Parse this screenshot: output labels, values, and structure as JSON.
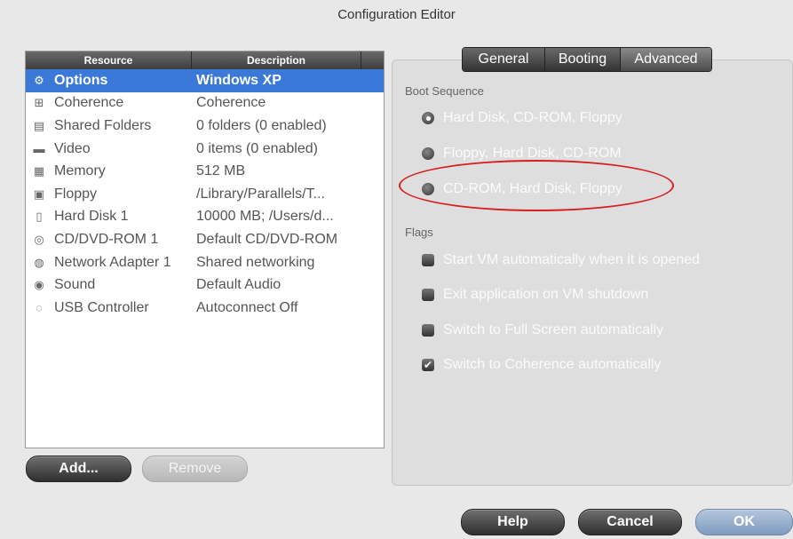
{
  "window": {
    "title": "Configuration Editor"
  },
  "list": {
    "headers": {
      "resource": "Resource",
      "description": "Description"
    },
    "rows": [
      {
        "icon": "gear-icon",
        "glyph": "⚙",
        "resource": "Options",
        "description": "Windows XP",
        "selected": true
      },
      {
        "icon": "coherence-icon",
        "glyph": "⊞",
        "resource": "Coherence",
        "description": "Coherence"
      },
      {
        "icon": "shared-folder-icon",
        "glyph": "▤",
        "resource": "Shared Folders",
        "description": "0 folders (0 enabled)"
      },
      {
        "icon": "monitor-icon",
        "glyph": "▬",
        "resource": "Video",
        "description": "0 items (0 enabled)"
      },
      {
        "icon": "memory-icon",
        "glyph": "▦",
        "resource": "Memory",
        "description": "512 MB"
      },
      {
        "icon": "floppy-icon",
        "glyph": "▣",
        "resource": "Floppy",
        "description": "/Library/Parallels/T..."
      },
      {
        "icon": "hard-disk-icon",
        "glyph": "▯",
        "resource": "Hard Disk 1",
        "description": "10000 MB; /Users/d..."
      },
      {
        "icon": "cd-icon",
        "glyph": "◎",
        "resource": "CD/DVD-ROM 1",
        "description": "Default CD/DVD-ROM"
      },
      {
        "icon": "network-icon",
        "glyph": "◍",
        "resource": "Network Adapter 1",
        "description": "Shared networking"
      },
      {
        "icon": "sound-icon",
        "glyph": "◉",
        "resource": "Sound",
        "description": "Default Audio"
      },
      {
        "icon": "usb-icon",
        "glyph": "◌",
        "resource": "USB Controller",
        "description": "Autoconnect Off"
      }
    ],
    "add_label": "Add...",
    "remove_label": "Remove"
  },
  "tabs": [
    {
      "label": "General",
      "active": false
    },
    {
      "label": "Booting",
      "active": false
    },
    {
      "label": "Advanced",
      "active": true
    }
  ],
  "boot": {
    "section_label": "Boot Sequence",
    "options": [
      {
        "label": "Hard Disk, CD-ROM, Floppy",
        "selected": true
      },
      {
        "label": "Floppy, Hard Disk, CD-ROM",
        "selected": false
      },
      {
        "label": "CD-ROM, Hard Disk, Floppy",
        "selected": false
      }
    ]
  },
  "flags": {
    "section_label": "Flags",
    "items": [
      {
        "label": "Start VM automatically when it is opened",
        "checked": false
      },
      {
        "label": "Exit application on VM shutdown",
        "checked": false
      },
      {
        "label": "Switch to Full Screen automatically",
        "checked": false
      },
      {
        "label": "Switch to Coherence automatically",
        "checked": true
      }
    ]
  },
  "footer": {
    "help_label": "Help",
    "cancel_label": "Cancel",
    "ok_label": "OK"
  },
  "colors": {
    "selection": "#3b79d8",
    "annotation": "#d62020"
  }
}
